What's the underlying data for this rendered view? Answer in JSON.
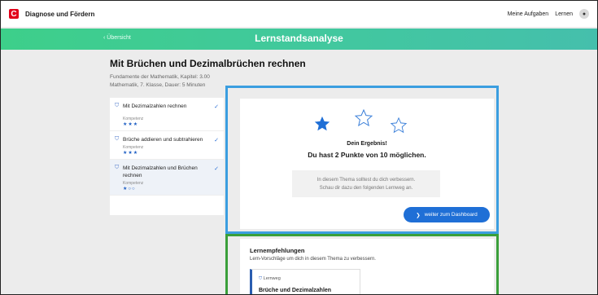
{
  "app": {
    "logo_letter": "C",
    "title": "Diagnose und Fördern",
    "nav_tasks": "Meine Aufgaben",
    "nav_learn": "Lernen"
  },
  "banner": {
    "back_label": "‹ Übersicht",
    "title": "Lernstandsanalyse"
  },
  "heading": {
    "title": "Mit Brüchen und Dezimalbrüchen rechnen",
    "line1": "Fundamente der Mathematik,  Kapitel: 3.00",
    "line2": "Mathematik,  7. Klasse,  Dauer: 5 Minuten"
  },
  "topics": [
    {
      "label": "Mit Dezimalzahlen rechnen",
      "kompetenz_label": "Kompetenz",
      "stars": "★★★"
    },
    {
      "label": "Brüche addieren und subtrahieren",
      "kompetenz_label": "Kompetenz",
      "stars": "★★★"
    },
    {
      "label": "Mit Dezimalzahlen und Brüchen rechnen",
      "kompetenz_label": "Kompetenz",
      "stars": "★○○"
    }
  ],
  "result": {
    "title": "Dein Ergebnis!",
    "points": "Du hast 2 Punkte von 10 möglichen.",
    "advice_line1": "In diesem Thema solltest du dich verbessern.",
    "advice_line2": "Schau dir dazu den folgenden Lernweg an.",
    "button_label": "weiter zum Dashboard",
    "stars_filled": 1,
    "stars_total": 3
  },
  "recommendations": {
    "title": "Lernempfehlungen",
    "subtitle": "Lern-Vorschläge um dich in diesem Thema zu verbessern.",
    "card_label": "Lernweg",
    "card_title": "Brüche und Dezimalzahlen"
  },
  "colors": {
    "brand_red": "#e2001a",
    "banner_green": "#3dcf8a",
    "primary_blue": "#1f6fd6",
    "highlight_blue": "#3b9ee0",
    "highlight_green": "#3a9f3a"
  }
}
